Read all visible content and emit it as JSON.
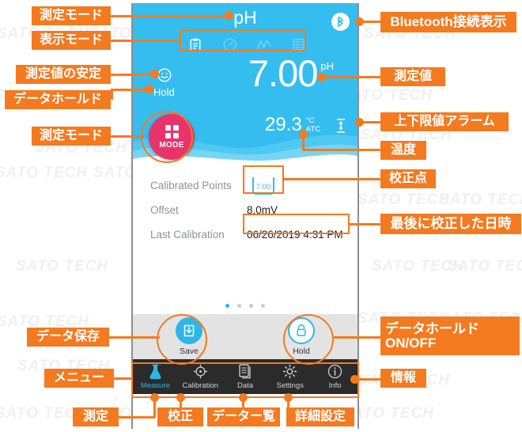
{
  "app": {
    "screen_title": "pH",
    "display_mode_icons": [
      "clipboard-icon",
      "gauge-icon",
      "trend-graph-icon",
      "table-icon"
    ],
    "bluetooth_icon": "bluetooth-icon",
    "stability_icon": "smiley-stable-icon",
    "hold_label": "Hold",
    "measurement": {
      "value": "7.00",
      "unit": "pH"
    },
    "temperature": {
      "value": "29.3",
      "unit_line1": "°C",
      "unit_line2": "ATC"
    },
    "alarm_icon": "high-low-limit-alarm-icon",
    "mode_button": {
      "label": "MODE",
      "icon": "grid-2x2-icon"
    },
    "info_rows": [
      {
        "label": "Calibrated Points",
        "value": "7.00",
        "type": "beaker"
      },
      {
        "label": "Offset",
        "value": "8.0mV",
        "type": "text"
      },
      {
        "label": "Last Calibration",
        "value": "06/26/2019 4:31 PM",
        "type": "text"
      }
    ],
    "page_dots": {
      "count": 4,
      "active_index": 0
    },
    "actions": [
      {
        "label": "Save",
        "icon": "save-download-icon",
        "style": "filled"
      },
      {
        "label": "Hold",
        "icon": "lock-icon",
        "style": "outline"
      }
    ],
    "tabs": [
      {
        "label": "Measure",
        "icon": "flask-icon",
        "active": true
      },
      {
        "label": "Calibration",
        "icon": "crosshair-icon",
        "active": false
      },
      {
        "label": "Data",
        "icon": "document-list-icon",
        "active": false
      },
      {
        "label": "Settings",
        "icon": "gear-icon",
        "active": false
      },
      {
        "label": "Info",
        "icon": "info-circle-icon",
        "active": false
      }
    ]
  },
  "annotations": {
    "left": [
      {
        "text": "測定モード"
      },
      {
        "text": "表示モード"
      },
      {
        "text": "測定値の安定"
      },
      {
        "text": "データホールド"
      },
      {
        "text": "測定モード"
      },
      {
        "text": "データ保存"
      },
      {
        "text": "メニュー"
      }
    ],
    "right": [
      {
        "text": "Bluetooth接続表示"
      },
      {
        "text": "測定値"
      },
      {
        "text": "上下限値アラーム"
      },
      {
        "text": "温度"
      },
      {
        "text": "校正点"
      },
      {
        "text": "最後に校正した日時"
      },
      {
        "text_line1": "データホールド",
        "text_line2": "ON/OFF"
      },
      {
        "text": "情報"
      }
    ],
    "bottom": [
      {
        "text": "測定"
      },
      {
        "text": "校正"
      },
      {
        "text": "データー覧"
      },
      {
        "text": "詳細設定"
      }
    ]
  },
  "watermark": {
    "text": "SATO TECH"
  },
  "colors": {
    "accent_orange": "#f47a20",
    "panel_blue": "#35bdef",
    "mode_pink": "#e8336b",
    "tabbar_dark": "#2b2b2b",
    "active_blue": "#2fb6e8"
  }
}
